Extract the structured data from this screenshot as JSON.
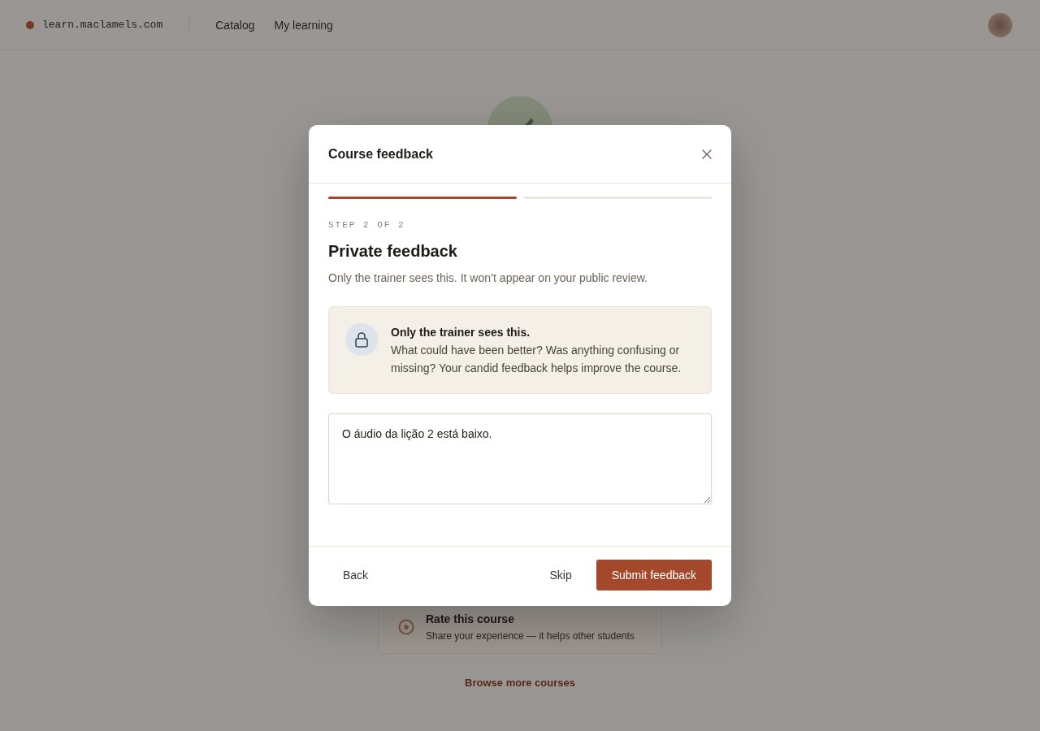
{
  "page": {
    "brand": "learn.maclamels.com",
    "nav": [
      {
        "label": "Catalog"
      },
      {
        "label": "My learning"
      }
    ],
    "rate_card": {
      "title": "Rate this course",
      "subtitle": "Share your experience — it helps other students"
    },
    "browse_link": "Browse more courses"
  },
  "dialog": {
    "title": "Course feedback",
    "progress": [
      {
        "complete": true
      },
      {
        "complete": false
      }
    ],
    "step_label": "STEP 2 OF 2",
    "heading": "Private feedback",
    "subtitle": "Only the trainer sees this. It won’t appear on your public review.",
    "notice": {
      "title": "Only the trainer sees this.",
      "text": "What could have been better? Was anything confusing or missing? Your candid feedback helps improve the course."
    },
    "feedback": {
      "value": "O áudio da lição 2 está baixo."
    },
    "buttons": [
      {
        "label": "Back",
        "kind": "text"
      },
      {
        "label": "Skip",
        "kind": "text"
      },
      {
        "label": "Submit feedback",
        "kind": "primary"
      }
    ]
  }
}
